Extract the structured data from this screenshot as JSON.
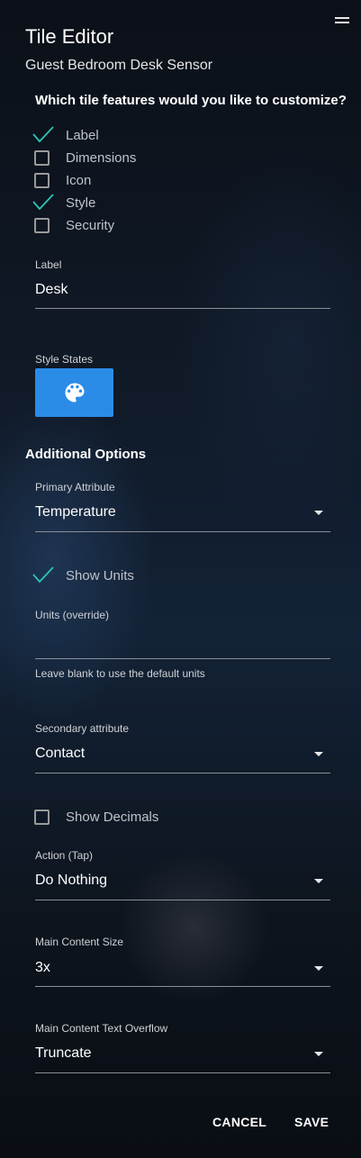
{
  "header": {
    "title": "Tile Editor",
    "subtitle": "Guest Bedroom Desk Sensor",
    "menu_icon": "hamburger-menu-icon"
  },
  "features": {
    "question": "Which tile features would you like to customize?",
    "items": [
      {
        "label": "Label",
        "checked": true
      },
      {
        "label": "Dimensions",
        "checked": false
      },
      {
        "label": "Icon",
        "checked": false
      },
      {
        "label": "Style",
        "checked": true
      },
      {
        "label": "Security",
        "checked": false
      }
    ]
  },
  "label_field": {
    "label": "Label",
    "value": "Desk"
  },
  "style_states": {
    "label": "Style States",
    "icon": "palette-icon",
    "color": "#2b8ce8"
  },
  "additional": {
    "title": "Additional Options",
    "primary_attribute": {
      "label": "Primary Attribute",
      "value": "Temperature"
    },
    "show_units": {
      "label": "Show Units",
      "checked": true
    },
    "units_override": {
      "label": "Units (override)",
      "value": "",
      "helper": "Leave blank to use the default units"
    },
    "secondary_attribute": {
      "label": "Secondary attribute",
      "value": "Contact"
    },
    "show_decimals": {
      "label": "Show Decimals",
      "checked": false
    },
    "action_tap": {
      "label": "Action (Tap)",
      "value": "Do Nothing"
    },
    "main_content_size": {
      "label": "Main Content Size",
      "value": "3x"
    },
    "text_overflow": {
      "label": "Main Content Text Overflow",
      "value": "Truncate"
    }
  },
  "actions": {
    "cancel": "CANCEL",
    "save": "SAVE"
  },
  "colors": {
    "check": "#2ec4b6",
    "accent": "#2b8ce8"
  }
}
